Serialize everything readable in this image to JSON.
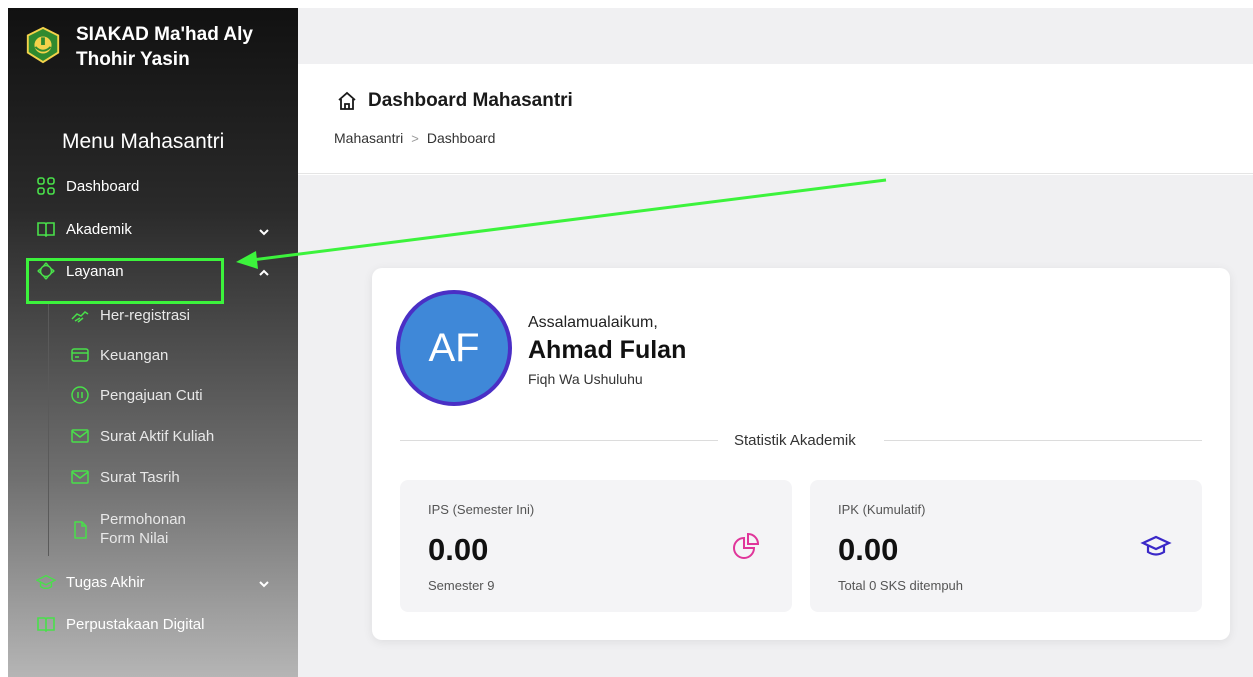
{
  "sidebar": {
    "brand_title": "SIAKAD Ma'had Aly Thohir Yasin",
    "menu_title": "Menu Mahasantri",
    "items": [
      {
        "label": "Dashboard",
        "icon": "grid-icon"
      },
      {
        "label": "Akademik",
        "icon": "book-icon",
        "expanded": false
      },
      {
        "label": "Layanan",
        "icon": "service-icon",
        "expanded": true
      },
      {
        "label": "Tugas Akhir",
        "icon": "graduation-cap-icon",
        "expanded": false
      },
      {
        "label": "Perpustakaan Digital",
        "icon": "book-icon"
      }
    ],
    "sub_items": [
      {
        "label": "Her-registrasi",
        "icon": "handshake-icon"
      },
      {
        "label": "Keuangan",
        "icon": "credit-card-icon"
      },
      {
        "label": "Pengajuan Cuti",
        "icon": "pause-circle-icon"
      },
      {
        "label": "Surat Aktif Kuliah",
        "icon": "mail-icon"
      },
      {
        "label": "Surat Tasrih",
        "icon": "mail-icon"
      },
      {
        "label": "Permohonan Form Nilai",
        "icon": "document-icon"
      }
    ]
  },
  "header": {
    "title": "Dashboard Mahasantri",
    "breadcrumb": [
      "Mahasantri",
      "Dashboard"
    ]
  },
  "profile": {
    "initials": "AF",
    "greeting": "Assalamualaikum,",
    "name": "Ahmad Fulan",
    "program": "Fiqh Wa Ushuluhu"
  },
  "stats": {
    "section_label": "Statistik Akademik",
    "ips": {
      "label": "IPS (Semester Ini)",
      "value": "0.00",
      "sub": "Semester 9",
      "icon": "pie-chart-icon"
    },
    "ipk": {
      "label": "IPK (Kumulatif)",
      "value": "0.00",
      "sub": "Total 0 SKS ditempuh",
      "icon": "graduation-cap-icon"
    }
  },
  "colors": {
    "highlight": "#3cf33c",
    "sidebar_icon": "#49e04a",
    "avatar_bg": "#3f88d8",
    "avatar_ring": "#4a2fc5",
    "ips_icon": "#e0359a",
    "ipk_icon": "#3a28c8"
  }
}
